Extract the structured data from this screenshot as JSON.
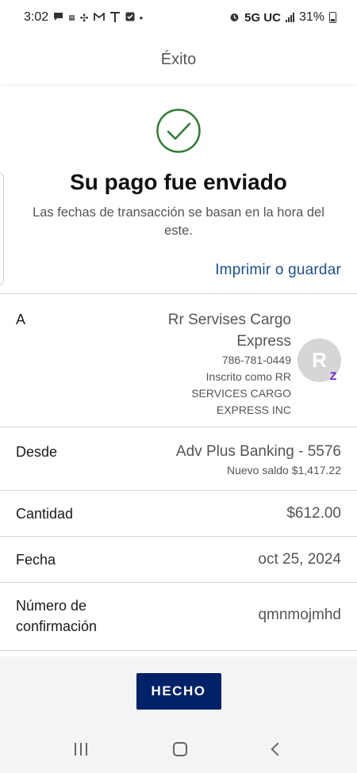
{
  "status_bar": {
    "time": "3:02",
    "network": "5G UC",
    "battery": "31%",
    "icons": [
      "chat-icon",
      "temu-icon",
      "slack-icon",
      "gmail-icon",
      "tmobile-icon",
      "check-icon",
      "dot-icon",
      "alarm-icon",
      "signal-icon",
      "battery-icon"
    ]
  },
  "header": {
    "title": "Éxito"
  },
  "success": {
    "title": "Su pago fue enviado",
    "note": "Las fechas de transacción se basan en la hora del este.",
    "print_link": "Imprimir o guardar"
  },
  "details": {
    "to": {
      "label": "A",
      "name": "Rr Servises Cargo Express",
      "phone": "786-781-0449",
      "enrolled": "Inscrito como RR SERVICES CARGO EXPRESS INC",
      "avatar_letter": "R",
      "badge": "Z"
    },
    "from": {
      "label": "Desde",
      "account": "Adv Plus Banking - 5576",
      "balance": "Nuevo saldo $1,417.22"
    },
    "amount": {
      "label": "Cantidad",
      "value": "$612.00"
    },
    "date": {
      "label": "Fecha",
      "value": "oct 25, 2024"
    },
    "confirmation": {
      "label": "Número de confirmación",
      "value": "qmnmojmhd"
    }
  },
  "footer": {
    "done_label": "HECHO"
  },
  "colors": {
    "success_green": "#2e7d32",
    "link_blue": "#1c4f8f",
    "button_navy": "#012169",
    "zelle_purple": "#6d1ed4"
  }
}
